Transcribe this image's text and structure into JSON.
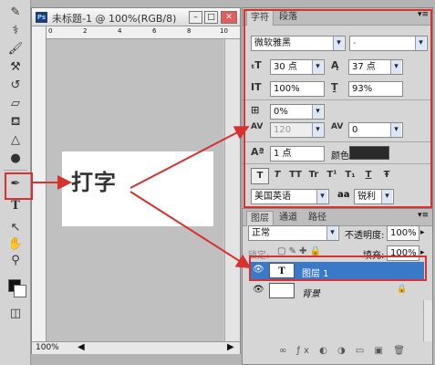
{
  "document": {
    "app_icon": "Ps",
    "title": "未标题-1 @ 100%(RGB/8)",
    "zoom": "100%",
    "canvas_text": "打字",
    "ruler_marks": [
      "0",
      "2",
      "4",
      "6",
      "8",
      "10"
    ]
  },
  "char_panel": {
    "tabs": [
      "字符",
      "段落"
    ],
    "font_family": "微软雅黑",
    "font_style": "-",
    "font_size": "30 点",
    "leading": "37 点",
    "vertical_scale": "100%",
    "horizontal_scale": "93%",
    "tsume": "0%",
    "kerning": "120",
    "tracking": "0",
    "baseline_shift": "1 点",
    "color_label": "颜色:",
    "color_value": "#2a2a2a",
    "format_buttons": [
      "T",
      "T",
      "TT",
      "Tr",
      "T¹",
      "T₁",
      "T",
      "Ŧ"
    ],
    "language": "美国英语",
    "aa_icon": "aa",
    "antialias": "锐利"
  },
  "layers_panel": {
    "tabs": [
      "图层",
      "通道",
      "路径"
    ],
    "blend_mode": "正常",
    "opacity_label": "不透明度:",
    "opacity_value": "100%",
    "lock_label": "锁定:",
    "fill_label": "填充:",
    "fill_value": "100%",
    "layers": [
      {
        "thumb": "T",
        "name": "图层 1",
        "selected": true
      },
      {
        "thumb": "",
        "name": "背景",
        "selected": false
      }
    ]
  },
  "colors": {
    "highlight": "#3a78c8",
    "annotation": "#d93030"
  }
}
